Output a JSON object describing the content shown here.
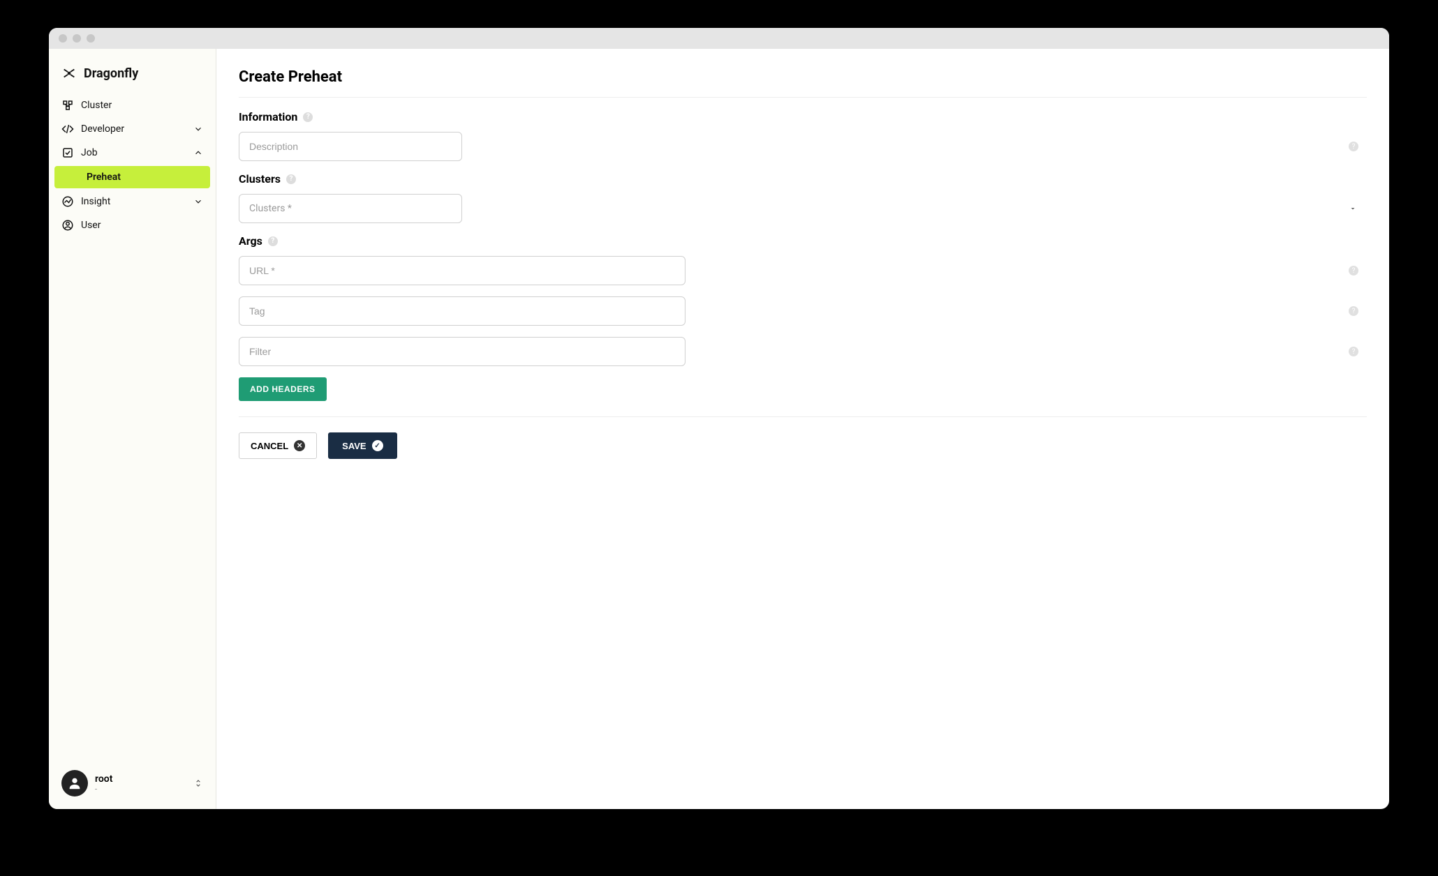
{
  "brand": {
    "name": "Dragonfly"
  },
  "sidebar": {
    "items": [
      {
        "label": "Cluster",
        "icon": "cluster-icon",
        "expandable": false
      },
      {
        "label": "Developer",
        "icon": "developer-icon",
        "expandable": true,
        "expanded": false
      },
      {
        "label": "Job",
        "icon": "job-icon",
        "expandable": true,
        "expanded": true,
        "children": [
          {
            "label": "Preheat",
            "active": true
          }
        ]
      },
      {
        "label": "Insight",
        "icon": "insight-icon",
        "expandable": true,
        "expanded": false
      },
      {
        "label": "User",
        "icon": "user-nav-icon",
        "expandable": false
      }
    ]
  },
  "user": {
    "name": "root",
    "subtitle": "-"
  },
  "page": {
    "title": "Create Preheat",
    "sections": {
      "information": {
        "heading": "Information"
      },
      "clusters": {
        "heading": "Clusters"
      },
      "args": {
        "heading": "Args"
      }
    },
    "fields": {
      "description": {
        "placeholder": "Description",
        "value": ""
      },
      "clusters": {
        "placeholder": "Clusters *",
        "value": ""
      },
      "url": {
        "placeholder": "URL *",
        "value": ""
      },
      "tag": {
        "placeholder": "Tag",
        "value": ""
      },
      "filter": {
        "placeholder": "Filter",
        "value": ""
      }
    },
    "buttons": {
      "add_headers": "ADD HEADERS",
      "cancel": "CANCEL",
      "save": "SAVE"
    }
  },
  "colors": {
    "accent_green": "#c6ef3b",
    "button_green": "#1f9c74",
    "button_dark": "#1a2d44"
  }
}
